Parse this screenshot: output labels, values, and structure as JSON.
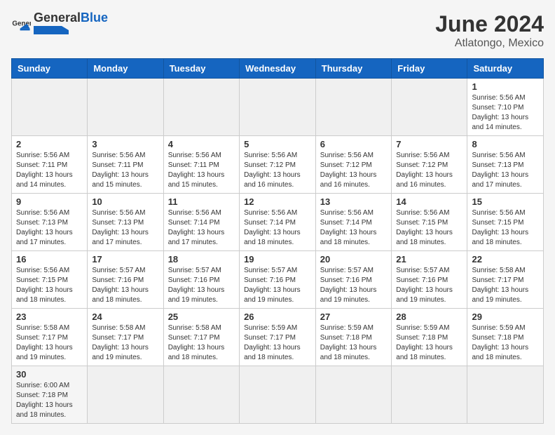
{
  "header": {
    "logo_general": "General",
    "logo_blue": "Blue",
    "month": "June 2024",
    "location": "Atlatongo, Mexico"
  },
  "weekdays": [
    "Sunday",
    "Monday",
    "Tuesday",
    "Wednesday",
    "Thursday",
    "Friday",
    "Saturday"
  ],
  "weeks": [
    [
      {
        "day": "",
        "info": ""
      },
      {
        "day": "",
        "info": ""
      },
      {
        "day": "",
        "info": ""
      },
      {
        "day": "",
        "info": ""
      },
      {
        "day": "",
        "info": ""
      },
      {
        "day": "",
        "info": ""
      },
      {
        "day": "1",
        "info": "Sunrise: 5:56 AM\nSunset: 7:10 PM\nDaylight: 13 hours\nand 14 minutes."
      }
    ],
    [
      {
        "day": "2",
        "info": "Sunrise: 5:56 AM\nSunset: 7:11 PM\nDaylight: 13 hours\nand 14 minutes."
      },
      {
        "day": "3",
        "info": "Sunrise: 5:56 AM\nSunset: 7:11 PM\nDaylight: 13 hours\nand 15 minutes."
      },
      {
        "day": "4",
        "info": "Sunrise: 5:56 AM\nSunset: 7:11 PM\nDaylight: 13 hours\nand 15 minutes."
      },
      {
        "day": "5",
        "info": "Sunrise: 5:56 AM\nSunset: 7:12 PM\nDaylight: 13 hours\nand 16 minutes."
      },
      {
        "day": "6",
        "info": "Sunrise: 5:56 AM\nSunset: 7:12 PM\nDaylight: 13 hours\nand 16 minutes."
      },
      {
        "day": "7",
        "info": "Sunrise: 5:56 AM\nSunset: 7:12 PM\nDaylight: 13 hours\nand 16 minutes."
      },
      {
        "day": "8",
        "info": "Sunrise: 5:56 AM\nSunset: 7:13 PM\nDaylight: 13 hours\nand 17 minutes."
      }
    ],
    [
      {
        "day": "9",
        "info": "Sunrise: 5:56 AM\nSunset: 7:13 PM\nDaylight: 13 hours\nand 17 minutes."
      },
      {
        "day": "10",
        "info": "Sunrise: 5:56 AM\nSunset: 7:13 PM\nDaylight: 13 hours\nand 17 minutes."
      },
      {
        "day": "11",
        "info": "Sunrise: 5:56 AM\nSunset: 7:14 PM\nDaylight: 13 hours\nand 17 minutes."
      },
      {
        "day": "12",
        "info": "Sunrise: 5:56 AM\nSunset: 7:14 PM\nDaylight: 13 hours\nand 18 minutes."
      },
      {
        "day": "13",
        "info": "Sunrise: 5:56 AM\nSunset: 7:14 PM\nDaylight: 13 hours\nand 18 minutes."
      },
      {
        "day": "14",
        "info": "Sunrise: 5:56 AM\nSunset: 7:15 PM\nDaylight: 13 hours\nand 18 minutes."
      },
      {
        "day": "15",
        "info": "Sunrise: 5:56 AM\nSunset: 7:15 PM\nDaylight: 13 hours\nand 18 minutes."
      }
    ],
    [
      {
        "day": "16",
        "info": "Sunrise: 5:56 AM\nSunset: 7:15 PM\nDaylight: 13 hours\nand 18 minutes."
      },
      {
        "day": "17",
        "info": "Sunrise: 5:57 AM\nSunset: 7:16 PM\nDaylight: 13 hours\nand 18 minutes."
      },
      {
        "day": "18",
        "info": "Sunrise: 5:57 AM\nSunset: 7:16 PM\nDaylight: 13 hours\nand 19 minutes."
      },
      {
        "day": "19",
        "info": "Sunrise: 5:57 AM\nSunset: 7:16 PM\nDaylight: 13 hours\nand 19 minutes."
      },
      {
        "day": "20",
        "info": "Sunrise: 5:57 AM\nSunset: 7:16 PM\nDaylight: 13 hours\nand 19 minutes."
      },
      {
        "day": "21",
        "info": "Sunrise: 5:57 AM\nSunset: 7:16 PM\nDaylight: 13 hours\nand 19 minutes."
      },
      {
        "day": "22",
        "info": "Sunrise: 5:58 AM\nSunset: 7:17 PM\nDaylight: 13 hours\nand 19 minutes."
      }
    ],
    [
      {
        "day": "23",
        "info": "Sunrise: 5:58 AM\nSunset: 7:17 PM\nDaylight: 13 hours\nand 19 minutes."
      },
      {
        "day": "24",
        "info": "Sunrise: 5:58 AM\nSunset: 7:17 PM\nDaylight: 13 hours\nand 19 minutes."
      },
      {
        "day": "25",
        "info": "Sunrise: 5:58 AM\nSunset: 7:17 PM\nDaylight: 13 hours\nand 18 minutes."
      },
      {
        "day": "26",
        "info": "Sunrise: 5:59 AM\nSunset: 7:17 PM\nDaylight: 13 hours\nand 18 minutes."
      },
      {
        "day": "27",
        "info": "Sunrise: 5:59 AM\nSunset: 7:18 PM\nDaylight: 13 hours\nand 18 minutes."
      },
      {
        "day": "28",
        "info": "Sunrise: 5:59 AM\nSunset: 7:18 PM\nDaylight: 13 hours\nand 18 minutes."
      },
      {
        "day": "29",
        "info": "Sunrise: 5:59 AM\nSunset: 7:18 PM\nDaylight: 13 hours\nand 18 minutes."
      }
    ],
    [
      {
        "day": "30",
        "info": "Sunrise: 6:00 AM\nSunset: 7:18 PM\nDaylight: 13 hours\nand 18 minutes."
      },
      {
        "day": "",
        "info": ""
      },
      {
        "day": "",
        "info": ""
      },
      {
        "day": "",
        "info": ""
      },
      {
        "day": "",
        "info": ""
      },
      {
        "day": "",
        "info": ""
      },
      {
        "day": "",
        "info": ""
      }
    ]
  ]
}
